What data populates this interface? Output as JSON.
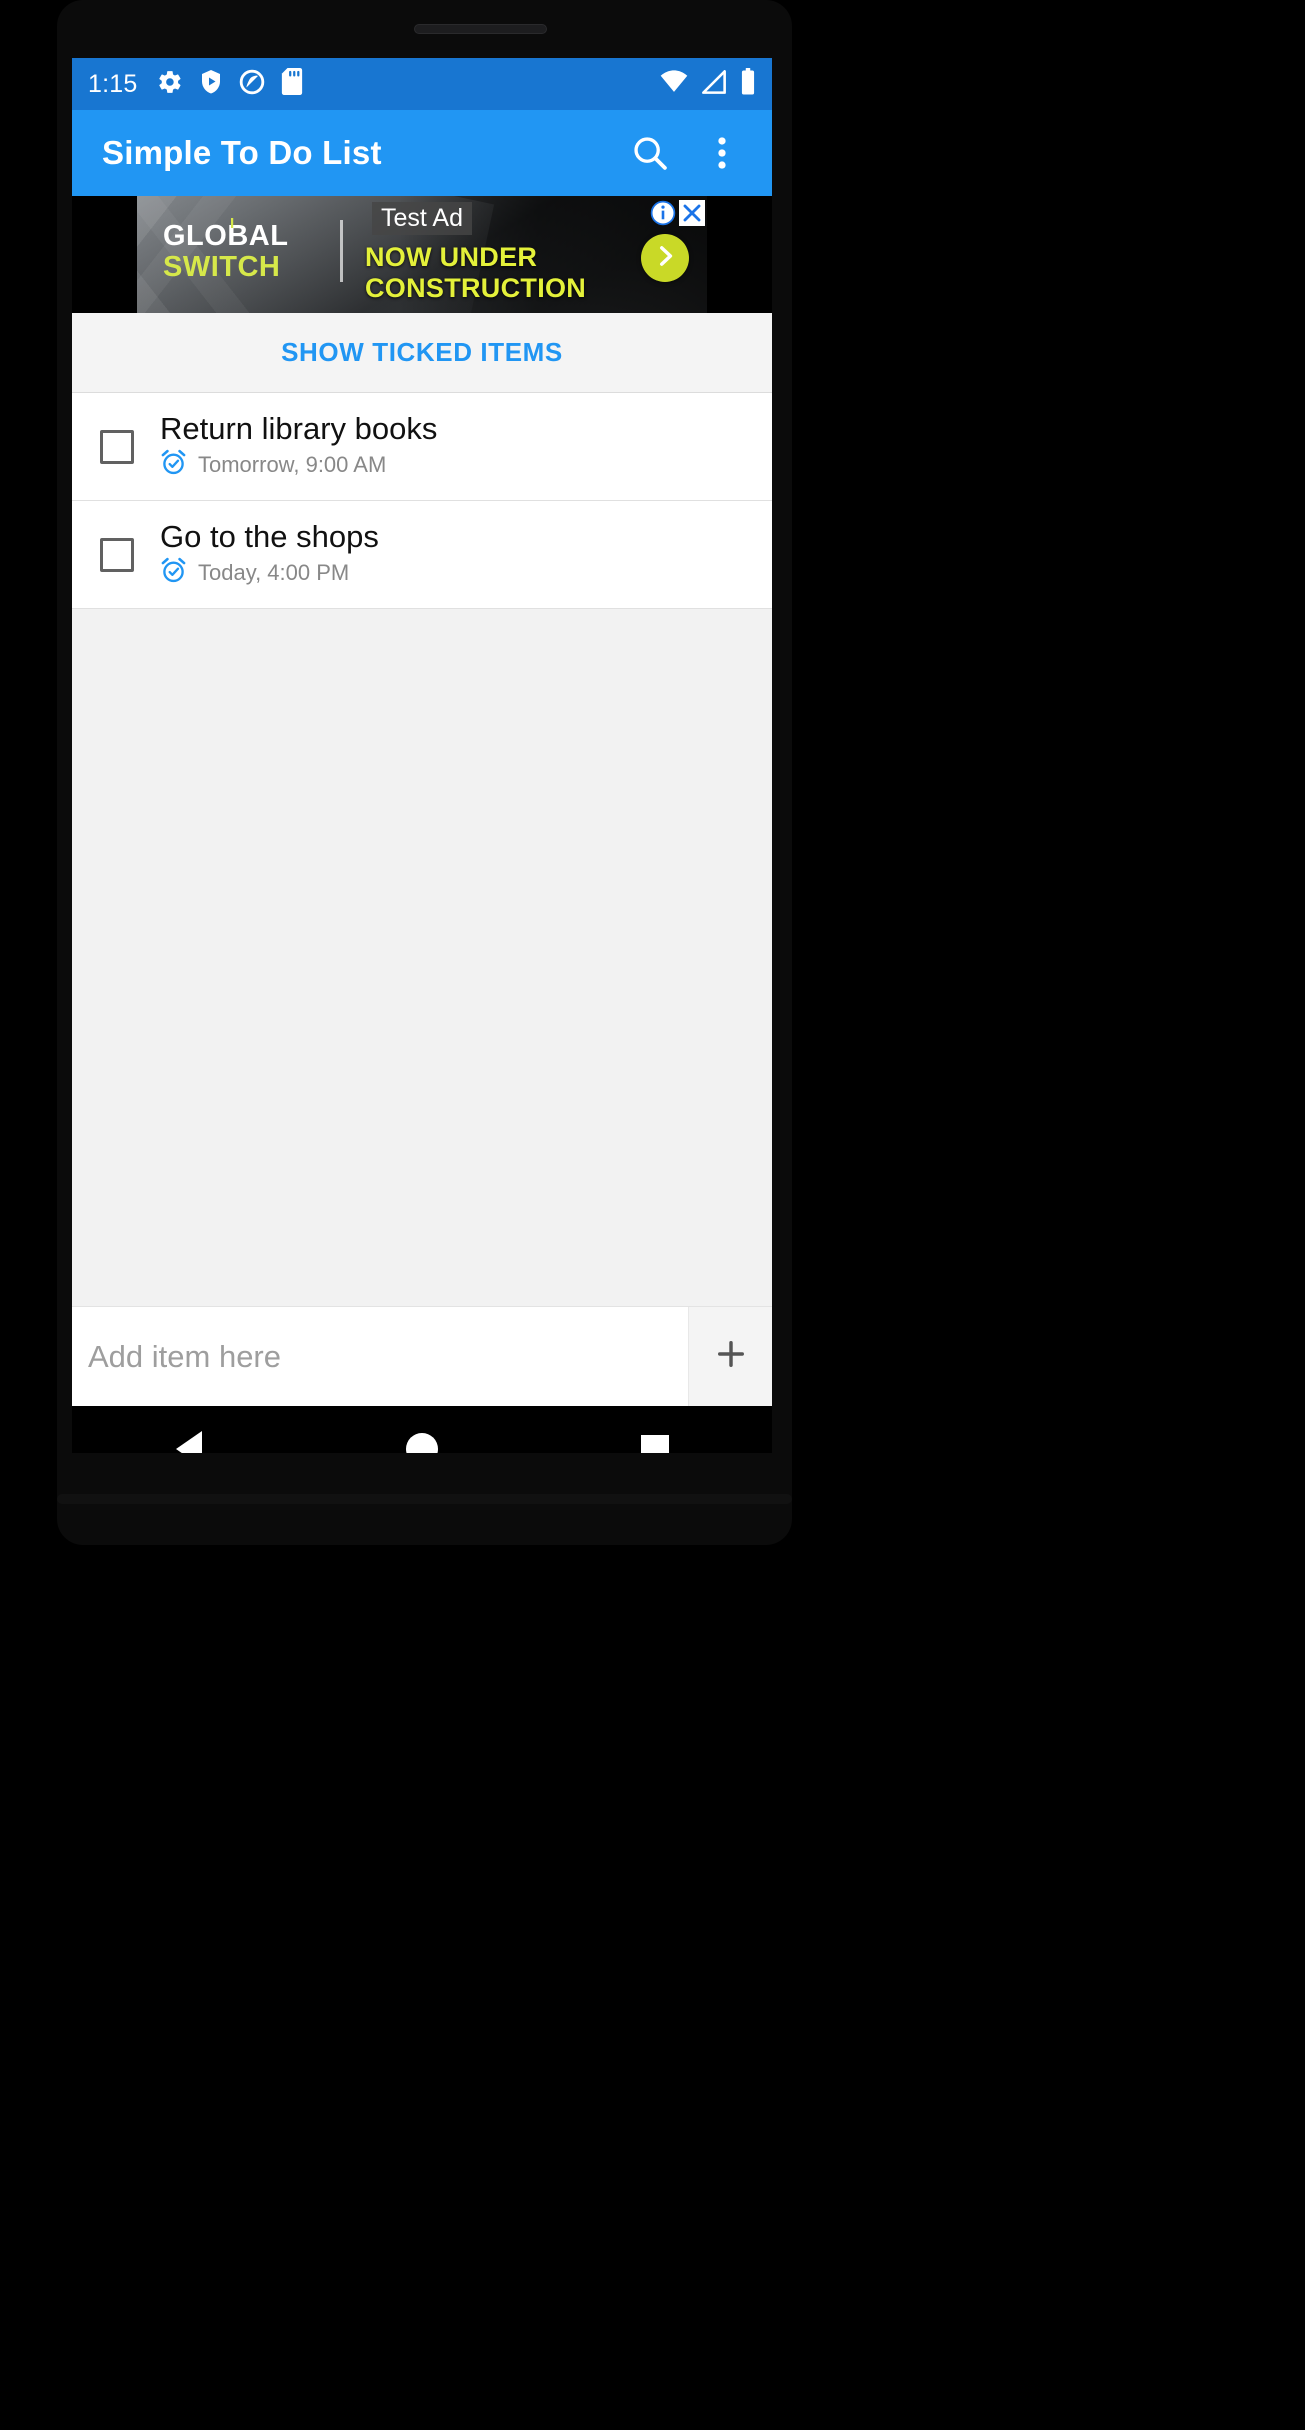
{
  "status_bar": {
    "clock": "1:15",
    "left_icons": [
      "gear-icon",
      "shield-play-icon",
      "circle-slash-icon",
      "sd-card-icon"
    ],
    "right_icons": [
      "wifi-icon",
      "cell-signal-icon",
      "battery-icon"
    ],
    "background_color": "#1876D1"
  },
  "app_bar": {
    "title": "Simple To Do List",
    "background_color": "#2196F3",
    "actions": [
      {
        "name": "search-icon",
        "label": "Search"
      },
      {
        "name": "overflow-menu-icon",
        "label": "More options"
      }
    ]
  },
  "ad": {
    "test_label": "Test Ad",
    "logo_line1": "GLOBAL",
    "logo_line2": "SWITCH",
    "headline": "NOW UNDER CONSTRUCTION",
    "cta_icon": "chevron-right-icon",
    "info_icon": "ad-info-icon",
    "close_icon": "ad-close-icon",
    "accent_color": "#D6E84A"
  },
  "toolbar": {
    "show_ticked_label": "SHOW TICKED ITEMS",
    "link_color": "#2196F3"
  },
  "tasks": [
    {
      "title": "Return library books",
      "due": "Tomorrow, 9:00 AM",
      "checked": false,
      "reminder_icon": "alarm-clock-icon"
    },
    {
      "title": "Go to the shops",
      "due": "Today, 4:00 PM",
      "checked": false,
      "reminder_icon": "alarm-clock-icon"
    }
  ],
  "add_bar": {
    "placeholder": "Add item here",
    "value": "",
    "add_icon": "plus-icon"
  },
  "nav_bar": {
    "back": "back-button",
    "home": "home-button",
    "recents": "recents-button"
  }
}
